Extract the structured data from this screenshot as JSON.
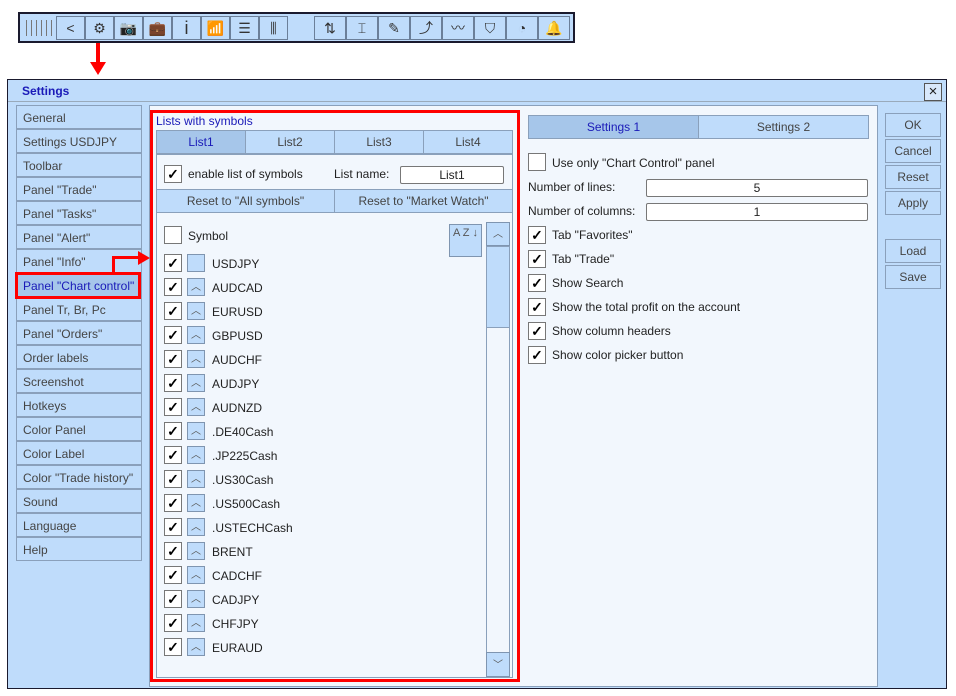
{
  "toolbar": {
    "icons": [
      "chevron-left-icon",
      "gear-icon",
      "camera-icon",
      "briefcase-icon",
      "info-icon",
      "signal-bars-icon",
      "list-icon",
      "candlestick-icon",
      "sort-arrows-icon",
      "level-line-icon",
      "edit-document-icon",
      "trend-up-icon",
      "chart-trend-icon",
      "shield-icon",
      "pie-chart-icon",
      "bell-icon"
    ],
    "glyphs": [
      "<",
      "⚙",
      "📷",
      "💼",
      "i",
      "📶",
      "☰",
      "⫼",
      "⇅",
      "⌶",
      "✎",
      "⤴",
      "〰",
      "⛉",
      "◔",
      "🔔"
    ]
  },
  "dialog": {
    "title": "Settings",
    "close": "×"
  },
  "sidebar": {
    "items": [
      "General",
      "Settings USDJPY",
      "Toolbar",
      "Panel \"Trade\"",
      "Panel \"Tasks\"",
      "Panel \"Alert\"",
      "Panel \"Info\"",
      "Panel \"Chart control\"",
      "Panel Tr, Br, Pc",
      "Panel \"Orders\"",
      "Order labels",
      "Screenshot",
      "Hotkeys",
      "Color Panel",
      "Color Label",
      "Color \"Trade history\"",
      "Sound",
      "Language",
      "Help"
    ],
    "active_index": 7
  },
  "lists": {
    "heading": "Lists with symbols",
    "tabs": [
      "List1",
      "List2",
      "List3",
      "List4"
    ],
    "active_tab": 0,
    "enable_label": "enable list of symbols",
    "enable_checked": true,
    "name_label": "List name:",
    "name_value": "List1",
    "reset_all": "Reset to \"All symbols\"",
    "reset_mw": "Reset to \"Market Watch\"",
    "header_label": "Symbol",
    "sort": "A Z ↓",
    "symbols": [
      "USDJPY",
      "AUDCAD",
      "EURUSD",
      "GBPUSD",
      "AUDCHF",
      "AUDJPY",
      "AUDNZD",
      ".DE40Cash",
      ".JP225Cash",
      ".US30Cash",
      ".US500Cash",
      ".USTECHCash",
      "BRENT",
      "CADCHF",
      "CADJPY",
      "CHFJPY",
      "EURAUD"
    ]
  },
  "settings": {
    "tabs": [
      "Settings 1",
      "Settings 2"
    ],
    "active_tab": 0,
    "use_only_label": "Use only \"Chart Control\" panel",
    "use_only_checked": false,
    "lines_label": "Number of lines:",
    "lines_value": "5",
    "columns_label": "Number of columns:",
    "columns_value": "1",
    "options": [
      {
        "label": "Tab \"Favorites\"",
        "checked": true
      },
      {
        "label": "Tab \"Trade\"",
        "checked": true
      },
      {
        "label": "Show Search",
        "checked": true
      },
      {
        "label": "Show the total profit on the account",
        "checked": true
      },
      {
        "label": "Show column headers",
        "checked": true
      },
      {
        "label": "Show color picker button",
        "checked": true
      }
    ]
  },
  "buttons": {
    "ok": "OK",
    "cancel": "Cancel",
    "reset": "Reset",
    "apply": "Apply",
    "load": "Load",
    "save": "Save"
  },
  "colors": {
    "panel": "#bfdcfb",
    "highlight": "#ff0000",
    "accent_text": "#1a1ab8"
  }
}
